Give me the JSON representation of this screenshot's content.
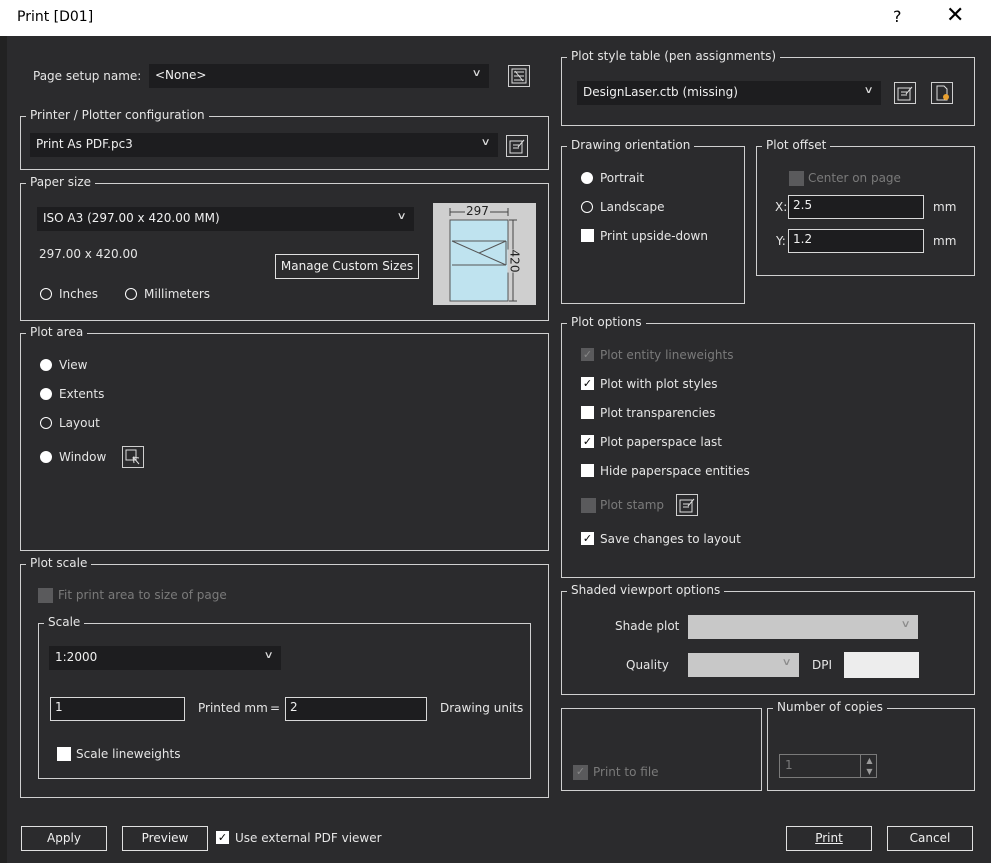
{
  "window": {
    "title": "Print [D01]",
    "help": "?",
    "close": "✕"
  },
  "page_setup": {
    "label": "Page setup name:",
    "value": "<None>"
  },
  "printer": {
    "legend": "Printer / Plotter configuration",
    "value": "Print As PDF.pc3"
  },
  "paper": {
    "legend": "Paper size",
    "value": "ISO A3 (297.00 x 420.00 MM)",
    "dims": "297.00 x 420.00",
    "manage_button": "Manage Custom Sizes",
    "units": [
      "Inches",
      "Millimeters"
    ],
    "preview_width": "297",
    "preview_height": "420"
  },
  "plot_area": {
    "legend": "Plot area",
    "options": [
      "View",
      "Extents",
      "Layout",
      "Window"
    ]
  },
  "plot_scale": {
    "legend": "Plot scale",
    "fit": "Fit print area to size of page",
    "scale_legend": "Scale",
    "scale_value": "1:2000",
    "printed_value": "1",
    "printed_label": "Printed mm",
    "equals": "=",
    "drawing_value": "2",
    "drawing_label": "Drawing units",
    "lineweights": "Scale lineweights"
  },
  "plot_style": {
    "legend": "Plot style table (pen assignments)",
    "value": "DesignLaser.ctb (missing)"
  },
  "orientation": {
    "legend": "Drawing orientation",
    "portrait": "Portrait",
    "landscape": "Landscape",
    "upside_down": "Print upside-down"
  },
  "plot_offset": {
    "legend": "Plot offset",
    "center": "Center on page",
    "x_label": "X:",
    "x_value": "2.5",
    "y_label": "Y:",
    "y_value": "1.2",
    "unit": "mm"
  },
  "plot_options": {
    "legend": "Plot options",
    "items": [
      "Plot entity lineweights",
      "Plot with plot styles",
      "Plot transparencies",
      "Plot paperspace last",
      "Hide paperspace entities",
      "Plot stamp",
      "Save changes to layout"
    ]
  },
  "shaded": {
    "legend": "Shaded viewport options",
    "shade_label": "Shade plot",
    "quality_label": "Quality",
    "dpi_label": "DPI"
  },
  "print_to_file": {
    "label": "Print to file"
  },
  "copies": {
    "legend": "Number of copies",
    "value": "1"
  },
  "footer": {
    "apply": "Apply",
    "preview": "Preview",
    "external_pdf": "Use external PDF viewer",
    "print": "Print",
    "cancel": "Cancel"
  },
  "colors": {
    "background": "#2b2b2d",
    "field": "#1d1d1f",
    "border": "#d0d0d0"
  }
}
